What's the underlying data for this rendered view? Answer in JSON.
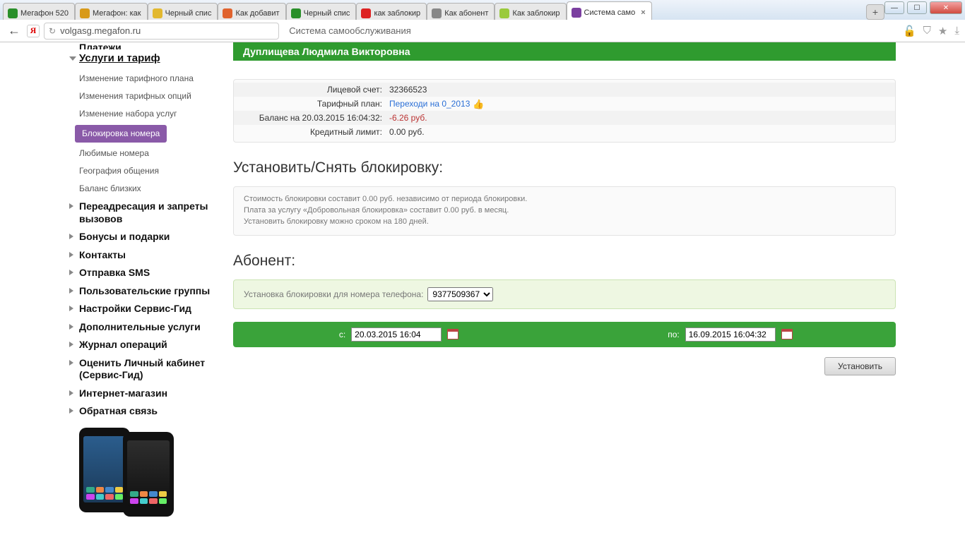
{
  "window": {
    "tabs": [
      {
        "label": "Мегафон 520",
        "fav": "#2a8f2a"
      },
      {
        "label": "Мегафон: как",
        "fav": "#d89a1a"
      },
      {
        "label": "Черный спис",
        "fav": "#e2b82f"
      },
      {
        "label": "Как добавит",
        "fav": "#e0632e"
      },
      {
        "label": "Черный спис",
        "fav": "#2a8f2a"
      },
      {
        "label": "как заблокир",
        "fav": "#d22"
      },
      {
        "label": "Как абонент",
        "fav": "#888"
      },
      {
        "label": "Как заблокир",
        "fav": "#9aca3c"
      },
      {
        "label": "Система само",
        "fav": "#7b3fa0",
        "active": true,
        "closeable": true
      }
    ]
  },
  "address": {
    "url": "volgasg.megafon.ru",
    "title": "Система самообслуживания"
  },
  "sidebar": {
    "top_cut": "Платежи",
    "active_section": "Услуги и тариф",
    "subs": [
      "Изменение тарифного плана",
      "Изменения тарифных опций",
      "Изменение набора услуг",
      "Блокировка номера",
      "Любимые номера",
      "География общения",
      "Баланс близких"
    ],
    "active_sub_index": 3,
    "sections": [
      "Переадресация и запреты вызовов",
      "Бонусы и подарки",
      "Контакты",
      "Отправка SMS",
      "Пользовательские группы",
      "Настройки Сервис-Гид",
      "Дополнительные услуги",
      "Журнал операций",
      "Оценить Личный кабинет (Сервис-Гид)",
      "Интернет-магазин",
      "Обратная связь"
    ]
  },
  "main": {
    "customer_name": "Дуплищева Людмила Викторовна",
    "info": {
      "labels": {
        "acct": "Лицевой счет:",
        "plan": "Тарифный план:",
        "balance": "Баланс на 20.03.2015 16:04:32:",
        "credit": "Кредитный лимит:"
      },
      "acct": "32366523",
      "plan": "Переходи на 0_2013",
      "balance": "-6.26 руб.",
      "credit": "0.00 руб."
    },
    "block_heading": "Установить/Снять блокировку:",
    "note_line1": "Стоимость блокировки составит 0.00 руб. независимо от периода блокировки.",
    "note_line2": "Плата за услугу «Добровольная блокировка» составит 0.00 руб. в месяц.",
    "note_line3": "Установить блокировку можно сроком на 180 дней.",
    "abon_heading": "Абонент:",
    "abon_label": "Установка блокировки для номера телефона:",
    "abon_phone": "9377509367",
    "date_labels": {
      "from": "с:",
      "to": "по:"
    },
    "date_from": "20.03.2015 16:04",
    "date_to": "16.09.2015 16:04:32",
    "install_btn": "Установить"
  }
}
